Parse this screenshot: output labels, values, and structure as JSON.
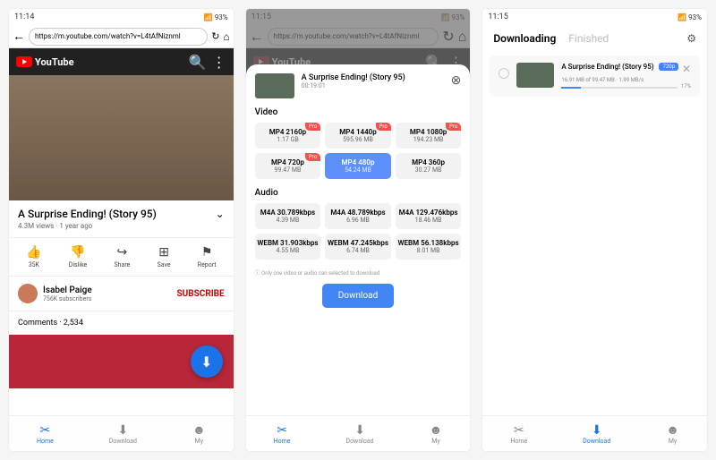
{
  "status": {
    "time1": "11:14",
    "time2": "11:15",
    "time3": "11:15",
    "battery": "93%"
  },
  "url": "https://m.youtube.com/watch?v=L4tAfNiznml",
  "youtube": "YouTube",
  "video": {
    "title": "A Surprise Ending! (Story 95)",
    "meta": "4.3M views · 1 year ago",
    "duration": "00:19:01"
  },
  "actions": {
    "like": "35K",
    "dislike": "Dislike",
    "share": "Share",
    "save": "Save",
    "report": "Report"
  },
  "channel": {
    "name": "Isabel Paige",
    "subs": "756K subscribers",
    "btn": "SUBSCRIBE"
  },
  "comments": "Comments · 2,534",
  "nav": {
    "home": "Home",
    "download": "Download",
    "my": "My"
  },
  "sheet": {
    "video_label": "Video",
    "audio_label": "Audio",
    "note": "ⓘ Only one video or audio can selected to download",
    "btn": "Download"
  },
  "v_opts": [
    {
      "fmt": "MP4 2160p",
      "sz": "1.17 GB",
      "pro": true
    },
    {
      "fmt": "MP4 1440p",
      "sz": "595.96 MB",
      "pro": true
    },
    {
      "fmt": "MP4 1080p",
      "sz": "194.23 MB",
      "pro": true
    },
    {
      "fmt": "MP4 720p",
      "sz": "99.47 MB",
      "pro": true
    },
    {
      "fmt": "MP4 480p",
      "sz": "54.24 MB",
      "sel": true
    },
    {
      "fmt": "MP4 360p",
      "sz": "30.27 MB"
    }
  ],
  "a_opts": [
    {
      "fmt": "M4A 30.789kbps",
      "sz": "4.39 MB"
    },
    {
      "fmt": "M4A 48.789kbps",
      "sz": "6.96 MB"
    },
    {
      "fmt": "M4A 129.476kbps",
      "sz": "18.46 MB"
    },
    {
      "fmt": "WEBM 31.903kbps",
      "sz": "4.55 MB"
    },
    {
      "fmt": "WEBM 47.245kbps",
      "sz": "6.74 MB"
    },
    {
      "fmt": "WEBM 56.138kbps",
      "sz": "8.01 MB"
    }
  ],
  "tabs": {
    "downloading": "Downloading",
    "finished": "Finished"
  },
  "dl": {
    "title": "A Surprise Ending! (Story 95)",
    "stat": "16.91 MB of 99.47 MB · 1.99 MB/s",
    "badge": "720p",
    "pct": "17%"
  },
  "pro": "Pro"
}
